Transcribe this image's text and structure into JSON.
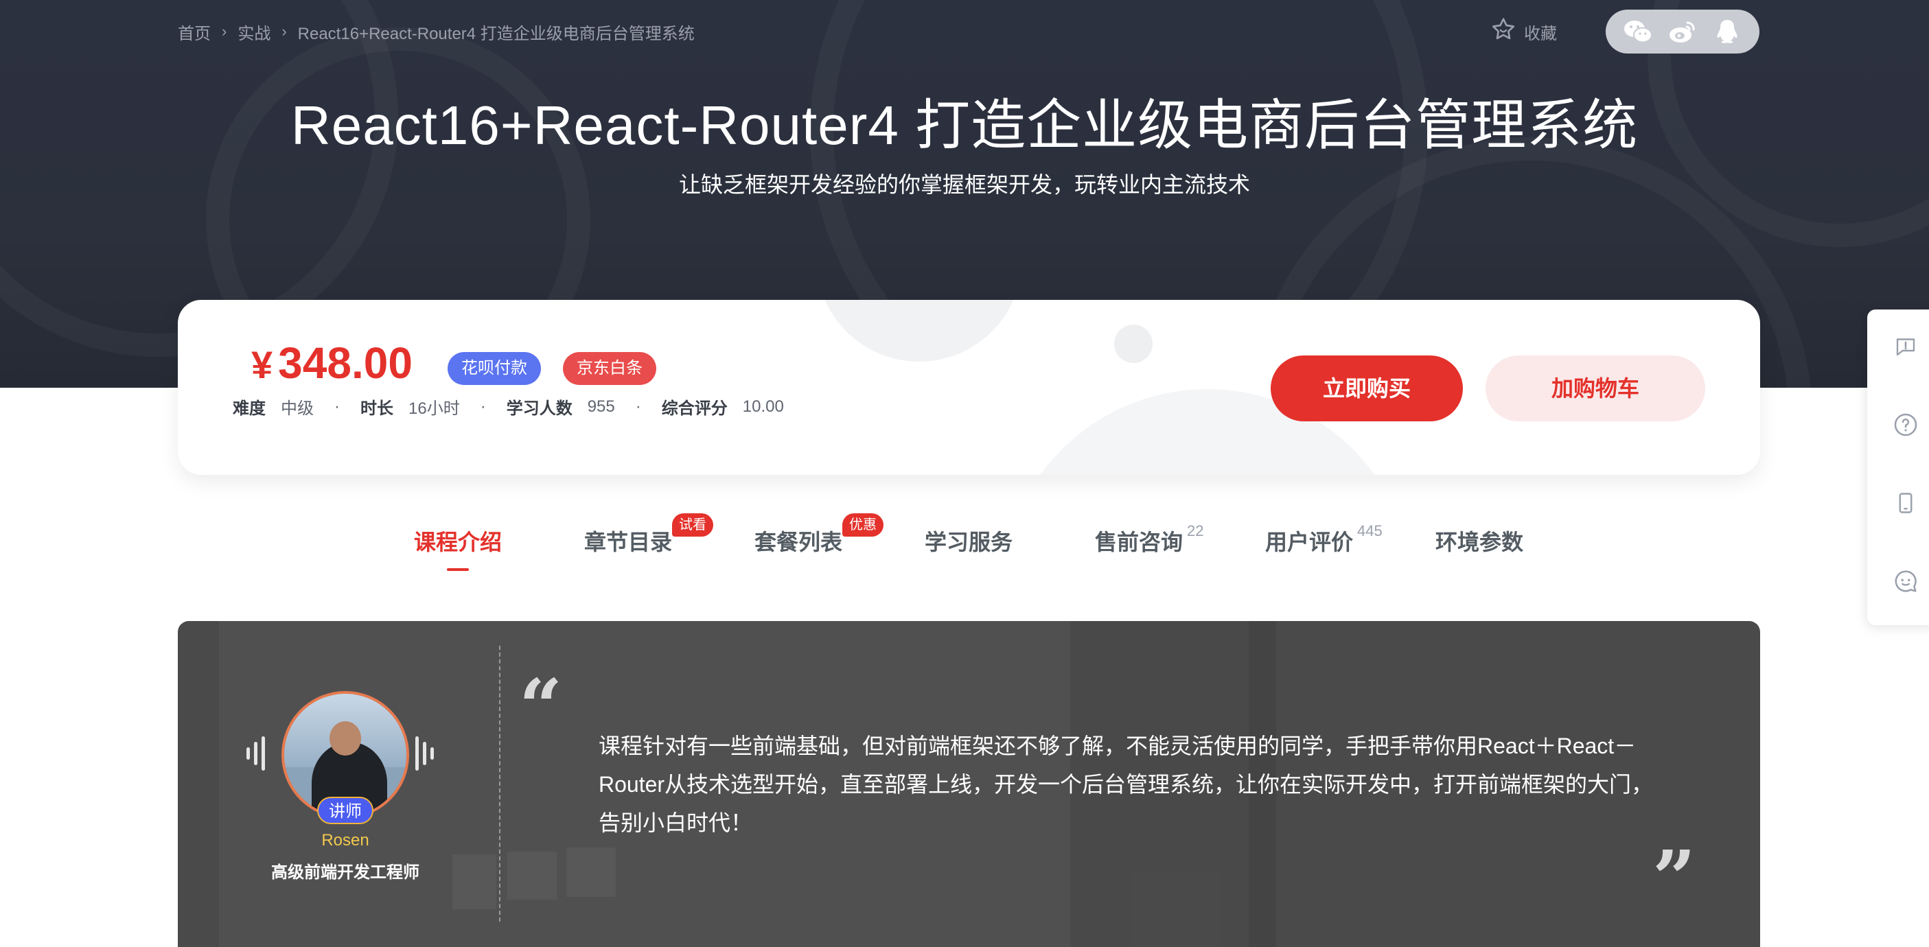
{
  "breadcrumb": {
    "items": [
      "首页",
      "实战",
      "React16+React-Router4 打造企业级电商后台管理系统"
    ],
    "sep": "›"
  },
  "header": {
    "collect_label": "收藏",
    "share_icons": [
      "wechat-icon",
      "weibo-icon",
      "qq-icon"
    ]
  },
  "course": {
    "title": "React16+React-Router4 打造企业级电商后台管理系统",
    "subtitle": "让缺乏框架开发经验的你掌握框架开发，玩转业内主流技术"
  },
  "pricing": {
    "currency": "¥",
    "price": "348.00",
    "badges": [
      "花呗付款",
      "京东白条"
    ],
    "meta": [
      {
        "key": "难度",
        "value": "中级"
      },
      {
        "key": "时长",
        "value": "16小时"
      },
      {
        "key": "学习人数",
        "value": "955"
      },
      {
        "key": "综合评分",
        "value": "10.00"
      }
    ],
    "meta_sep": "·",
    "buy_label": "立即购买",
    "cart_label": "加购物车"
  },
  "tabs": [
    {
      "label": "课程介绍",
      "active": true
    },
    {
      "label": "章节目录",
      "tag": "试看"
    },
    {
      "label": "套餐列表",
      "tag": "优惠"
    },
    {
      "label": "学习服务"
    },
    {
      "label": "售前咨询",
      "count": "22"
    },
    {
      "label": "用户评价",
      "count": "445"
    },
    {
      "label": "环境参数"
    }
  ],
  "intro": {
    "lecturer_tag": "讲师",
    "lecturer_name": "Rosen",
    "lecturer_title": "高级前端开发工程师",
    "text": "课程针对有一些前端基础，但对前端框架还不够了解，不能灵活使用的同学，手把手带你用React＋React－Router从技术选型开始，直至部署上线，开发一个后台管理系统，让你在实际开发中，打开前端框架的大门，告别小白时代！"
  },
  "sidebar": {
    "icons": [
      "feedback-icon",
      "help-icon",
      "mobile-icon",
      "chat-icon"
    ]
  },
  "colors": {
    "accent": "#e4312b",
    "hero_bg": "#2b303c",
    "huabei": "#5b74f0",
    "jd": "#e94c4c"
  }
}
